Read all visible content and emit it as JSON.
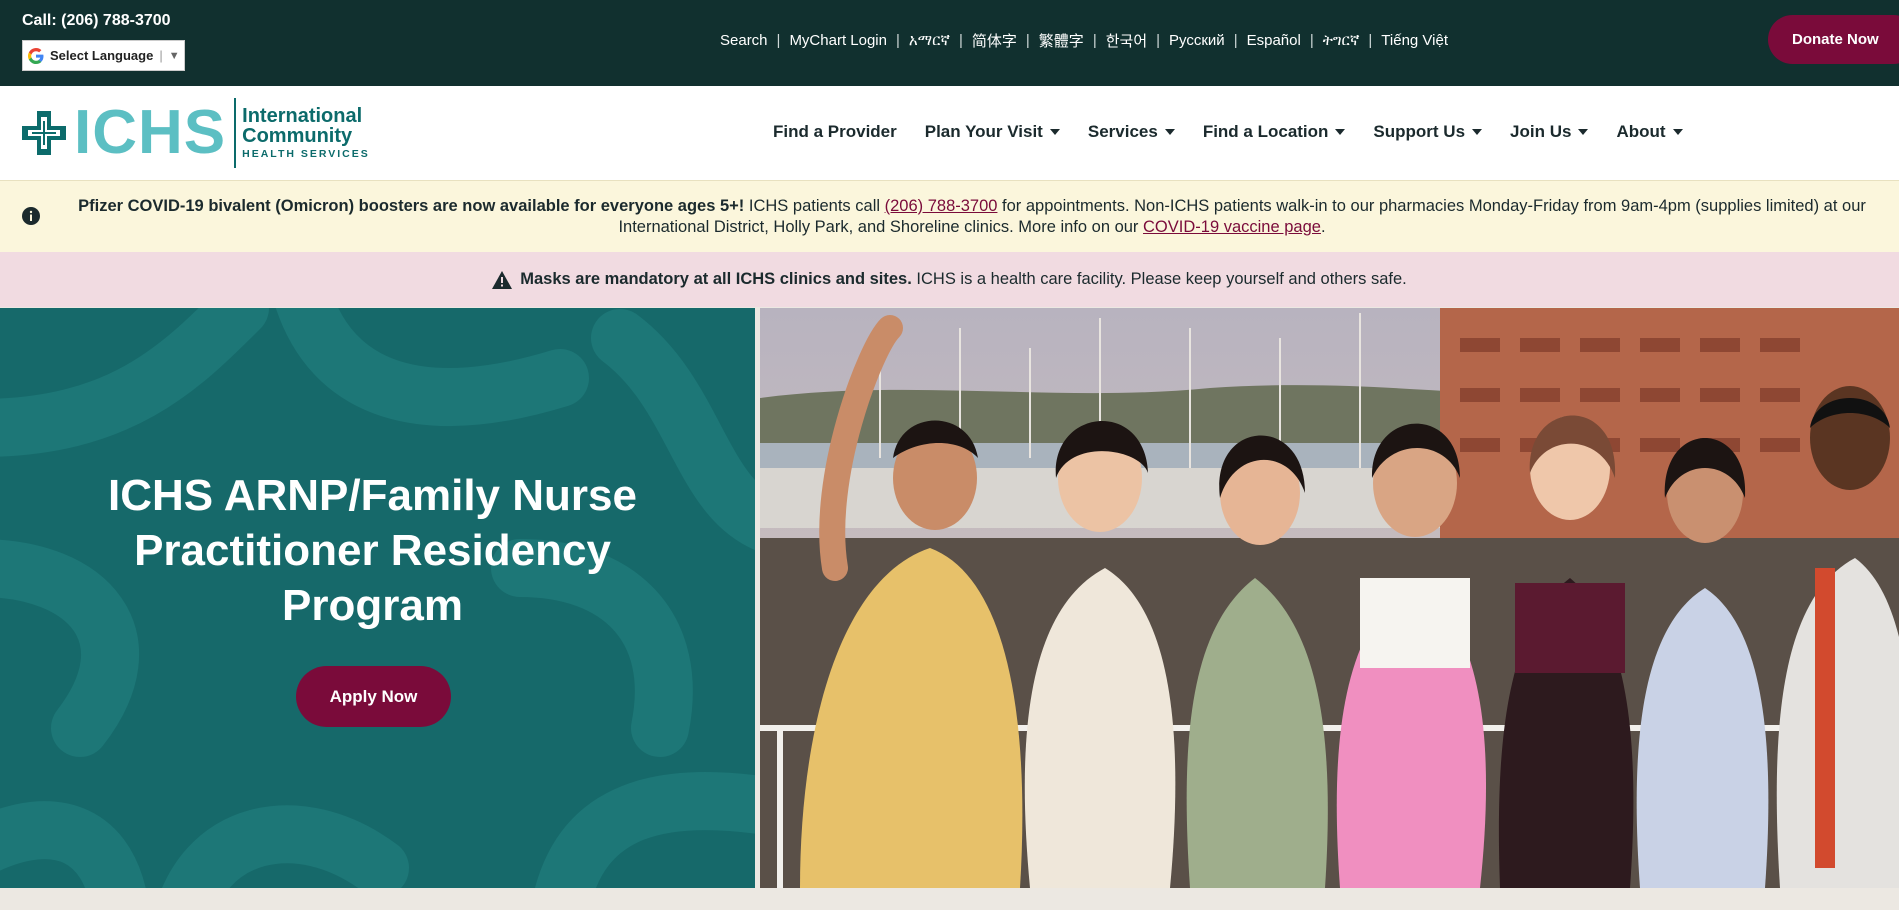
{
  "topbar": {
    "call": "Call: (206) 788-3700",
    "language_select": "Select Language",
    "links": [
      "Search",
      "MyChart Login",
      "አማርኛ",
      "简体字",
      "繁體字",
      "한국어",
      "Русский",
      "Español",
      "ትግርኛ",
      "Tiếng Việt"
    ],
    "donate": "Donate Now"
  },
  "header": {
    "logo": {
      "brand": "ICHS",
      "line1": "International",
      "line2": "Community",
      "line3": "HEALTH SERVICES"
    },
    "nav": [
      {
        "label": "Find a Provider",
        "dropdown": false
      },
      {
        "label": "Plan Your Visit",
        "dropdown": true
      },
      {
        "label": "Services",
        "dropdown": true
      },
      {
        "label": "Find a Location",
        "dropdown": true
      },
      {
        "label": "Support Us",
        "dropdown": true
      },
      {
        "label": "Join Us",
        "dropdown": true
      },
      {
        "label": "About",
        "dropdown": true
      }
    ]
  },
  "alerts": {
    "covid": {
      "bold": "Pfizer COVID-19 bivalent (Omicron) boosters are now available for everyone ages 5+!",
      "text1": " ICHS patients call ",
      "phone": "(206) 788-3700",
      "text2": " for appointments. Non-ICHS patients walk-in to our pharmacies Monday-Friday from 9am-4pm (supplies limited) at our International District, Holly Park, and Shoreline clinics. More info on our ",
      "link": "COVID-19 vaccine page",
      "text3": "."
    },
    "mask": {
      "bold": "Masks are mandatory at all ICHS clinics and sites.",
      "text": " ICHS is a health care facility. Please keep yourself and others safe."
    }
  },
  "hero": {
    "title": "ICHS ARNP/Family Nurse Practitioner Residency Program",
    "button": "Apply Now"
  },
  "colors": {
    "topbar_bg": "#11302f",
    "accent_maroon": "#7a0b3a",
    "teal": "#16696a",
    "logo_light_teal": "#5cbfc3",
    "covid_bg": "#fbf6dc",
    "mask_bg": "#f1dbe1"
  }
}
